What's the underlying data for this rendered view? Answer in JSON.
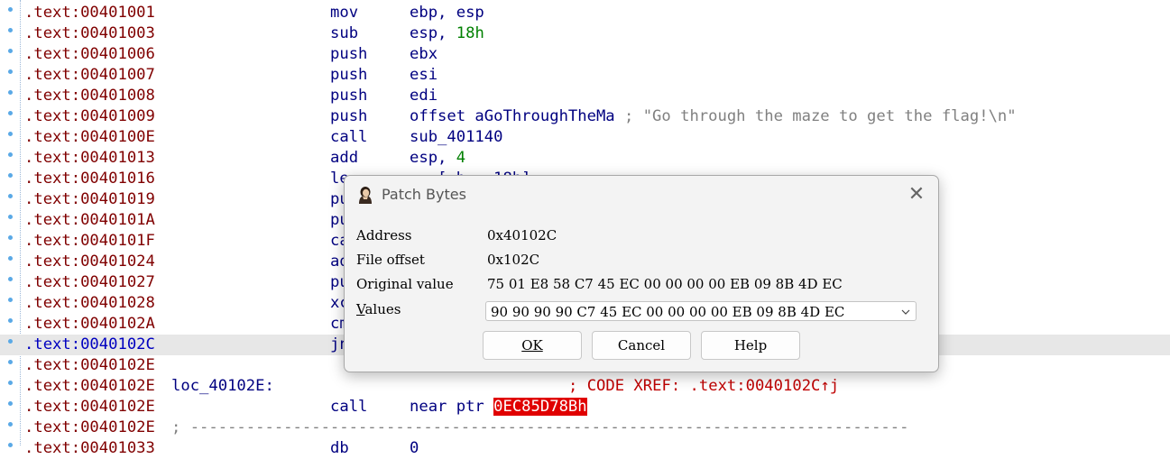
{
  "listing": {
    "rows": [
      {
        "addr": ".text:00401001",
        "mnemonic": "mov",
        "ops": "ebp, esp"
      },
      {
        "addr": ".text:00401003",
        "mnemonic": "sub",
        "ops": "esp, ",
        "num": "18h"
      },
      {
        "addr": ".text:00401006",
        "mnemonic": "push",
        "ops": "ebx"
      },
      {
        "addr": ".text:00401007",
        "mnemonic": "push",
        "ops": "esi"
      },
      {
        "addr": ".text:00401008",
        "mnemonic": "push",
        "ops": "edi"
      },
      {
        "addr": ".text:00401009",
        "mnemonic": "push",
        "ops": "offset aGoThroughTheMa",
        "comment": " ; \"Go through the maze to get the flag!\\n\""
      },
      {
        "addr": ".text:0040100E",
        "mnemonic": "call",
        "ops": "sub_401140"
      },
      {
        "addr": ".text:00401013",
        "mnemonic": "add",
        "ops": "esp, ",
        "num": "4"
      },
      {
        "addr": ".text:00401016",
        "mnemonic": "le",
        "ops": "   [ b   18h]"
      },
      {
        "addr": ".text:00401019",
        "mnemonic": "pu"
      },
      {
        "addr": ".text:0040101A",
        "mnemonic": "pu"
      },
      {
        "addr": ".text:0040101F",
        "mnemonic": "ca"
      },
      {
        "addr": ".text:00401024",
        "mnemonic": "ad"
      },
      {
        "addr": ".text:00401027",
        "mnemonic": "pu"
      },
      {
        "addr": ".text:00401028",
        "mnemonic": "xc"
      },
      {
        "addr": ".text:0040102A",
        "mnemonic": "cm"
      },
      {
        "addr": ".text:0040102C",
        "mnemonic": "jn"
      },
      {
        "addr": ".text:0040102E"
      },
      {
        "addr": ".text:0040102E",
        "label": "loc_40102E:",
        "xref": "; CODE XREF: .text:0040102C↑j"
      },
      {
        "addr": ".text:0040102E",
        "mnemonic": "call",
        "ops": "near ptr ",
        "target": "0EC85D78Bh"
      },
      {
        "addr": ".text:0040102E",
        "separator": "; -----------------------------------------------------------------------------"
      },
      {
        "addr": ".text:00401033",
        "mnemonic": "db",
        "ops": "0"
      }
    ]
  },
  "dialog": {
    "title": "Patch Bytes",
    "close_glyph": "✕",
    "address_label": "Address",
    "address_value": "0x40102C",
    "file_offset_label": "File offset",
    "file_offset_value": "0x102C",
    "original_label": "Original value",
    "original_value": "75 01 E8 58 C7 45 EC 00 00 00 00 EB 09 8B 4D EC",
    "values_label": "Values",
    "values_label_mnemonic": "V",
    "values_label_rest": "alues",
    "values_value": "90 90 90 90 C7 45 EC 00 00 00 00 EB 09 8B 4D EC",
    "ok_label": "OK",
    "cancel_label": "Cancel",
    "help_label": "Help"
  },
  "icons": {
    "app": "ida-portrait-icon",
    "close": "close-icon",
    "dropdown": "chevron-down-icon"
  },
  "colors": {
    "address": "#800000",
    "address_selected": "#0000c0",
    "mnemonic": "#000080",
    "number": "#008000",
    "xref": "#c00000",
    "target_bg": "#e00000",
    "highlight_row": "#e7e7e7"
  }
}
